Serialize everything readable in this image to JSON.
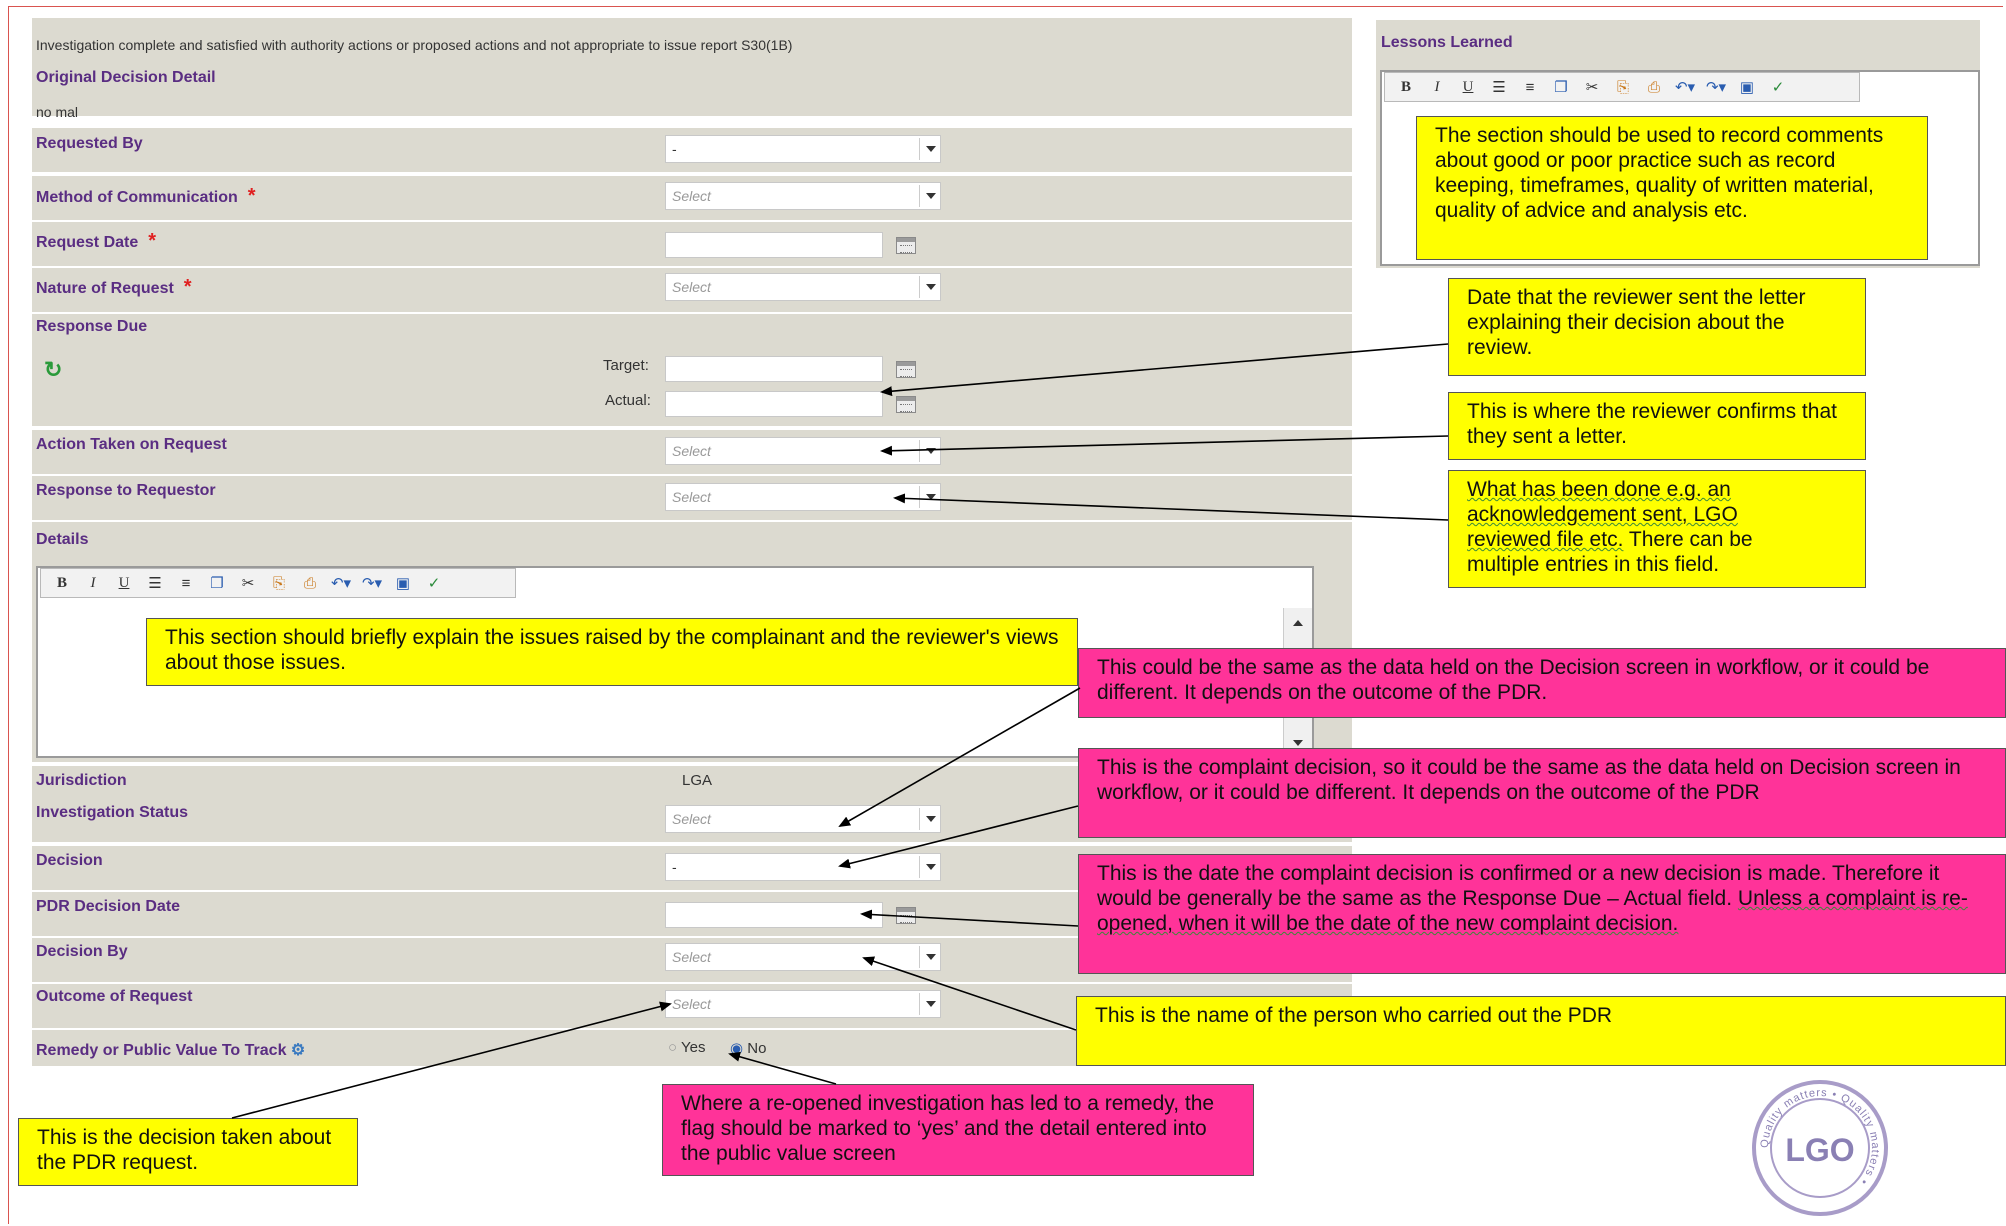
{
  "form": {
    "investigation_text": "Investigation complete and satisfied with authority actions or proposed actions and not appropriate to issue report S30(1B)",
    "original_decision_detail_label": "Original Decision Detail",
    "original_decision_detail_value": "no mal",
    "requested_by_label": "Requested By",
    "requested_by_value": "-",
    "method_label": "Method of Communication",
    "method_placeholder": "Select",
    "request_date_label": "Request Date",
    "nature_label": "Nature of Request",
    "nature_placeholder": "Select",
    "response_due_label": "Response Due",
    "target_label": "Target:",
    "actual_label": "Actual:",
    "action_taken_label": "Action Taken on Request",
    "action_taken_placeholder": "Select",
    "response_to_requestor_label": "Response to Requestor",
    "response_to_requestor_placeholder": "Select",
    "details_label": "Details",
    "jurisdiction_label": "Jurisdiction",
    "jurisdiction_value": "LGA",
    "investigation_status_label": "Investigation Status",
    "investigation_status_placeholder": "Select",
    "decision_label": "Decision",
    "decision_value": "-",
    "pdr_decision_date_label": "PDR Decision Date",
    "decision_by_label": "Decision By",
    "decision_by_placeholder": "Select",
    "outcome_label": "Outcome of Request",
    "outcome_placeholder": "Select",
    "remedy_label": "Remedy or Public Value To Track",
    "remedy_yes": "Yes",
    "remedy_no": "No",
    "required_mark": "*"
  },
  "lessons": {
    "title": "Lessons Learned"
  },
  "notes": {
    "lessons": "The  section should be used to record comments about good or poor practice such as record keeping, timeframes, quality of written material,  quality of advice and analysis etc.",
    "actual_date": "Date that the reviewer  sent the letter explaining their decision about the review.",
    "action_taken": "This is where  the reviewer confirms that they sent a letter.",
    "response_line1": "What has been done e.g. an",
    "response_line2": "acknowledgement sent, LGO",
    "response_line3": "reviewed file etc.",
    "response_line3b": " There  can be",
    "response_line4": "multiple entries in this field.",
    "details": "This section should briefly explain the issues raised by the complainant and the reviewer's views about those issues.",
    "investigation_status": "This could be the same as the data held on the Decision screen in workflow, or it could be different. It depends on the outcome of the PDR.",
    "decision": "This is the complaint decision, so it could be the same as the data held on Decision screen in workflow, or it could be different. It depends on the outcome of the PDR",
    "pdr_date_a": "This is the date the complaint decision is confirmed or a new decision is made. Therefore it would be generally  be the same as the Response Due – Actual field.",
    "pdr_date_b": "Unless a complaint is re-opened, when it will be the date of the new complaint decision.",
    "decision_by": "This is the name  of the person who carried out the PDR",
    "outcome": "This is the decision taken about the PDR request.",
    "remedy": "Where  a re-opened investigation has led to a remedy, the flag should be marked to ‘yes’ and the detail entered into the public value screen"
  },
  "logo": {
    "text": "LGO",
    "ring_text": "Quality matters"
  }
}
